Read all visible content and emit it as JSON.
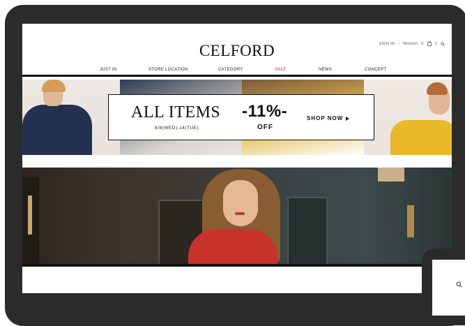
{
  "header": {
    "logo": "CELFORD",
    "utility": {
      "sign_in": "SIGN IN",
      "separator": "|",
      "wishlist": "Wishlist",
      "wishlist_count": "0",
      "cart_count": "0"
    },
    "nav": [
      "JUST IN",
      "STORE LOCATION",
      "CATEGORY",
      "SALE",
      "NEWS",
      "CONCEPT"
    ]
  },
  "banner": {
    "headline": "ALL ITEMS",
    "dates": "8/8(WED)-14(TUE)",
    "discount": "-11%-",
    "off_label": "OFF",
    "cta": "SHOP NOW"
  },
  "colors": {
    "sale": "#c0262d",
    "device_frame": "#2b2b2b",
    "dress": "#c8322b"
  },
  "tablet": {
    "search_icon": "search-icon"
  }
}
